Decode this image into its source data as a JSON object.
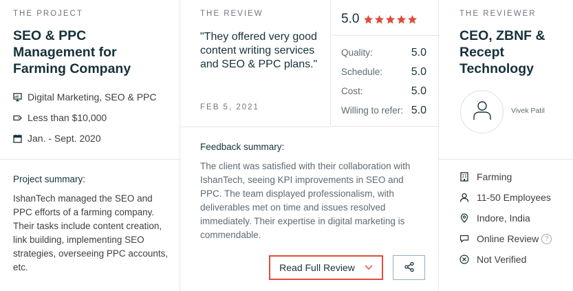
{
  "project": {
    "eyebrow": "THE PROJECT",
    "title": "SEO & PPC Management for Farming Company",
    "services": "Digital Marketing, SEO & PPC",
    "budget": "Less than $10,000",
    "dates": "Jan. - Sept. 2020",
    "summary_label": "Project summary:",
    "summary_text": "IshanTech managed the SEO and PPC efforts of a farming company. Their tasks include content creation, link building, implementing SEO strategies, overseeing PPC accounts, etc."
  },
  "review": {
    "eyebrow": "THE REVIEW",
    "quote": "\"They offered very good content writing services and SEO & PPC plans.\"",
    "date": "FEB 5, 2021",
    "overall": "5.0",
    "stars": 5,
    "star_color": "#e04b3a",
    "ratings": [
      {
        "label": "Quality:",
        "value": "5.0"
      },
      {
        "label": "Schedule:",
        "value": "5.0"
      },
      {
        "label": "Cost:",
        "value": "5.0"
      },
      {
        "label": "Willing to refer:",
        "value": "5.0"
      }
    ],
    "feedback_label": "Feedback summary:",
    "feedback_text": "The client was satisfied with their collaboration with IshanTech, seeing KPI improvements in SEO and PPC. The team displayed professionalism, with deliverables met on time and issues resolved immediately. Their expertise in digital marketing is commendable.",
    "read_full": "Read Full Review"
  },
  "reviewer": {
    "eyebrow": "THE REVIEWER",
    "title": "CEO, ZBNF & Recept Technology",
    "name": "Vivek Patil",
    "industry": "Farming",
    "size": "11-50 Employees",
    "location": "Indore, India",
    "review_type": "Online Review",
    "help_glyph": "?",
    "verification": "Not Verified"
  },
  "icons": {
    "services": "monitor-icon",
    "budget": "tag-icon",
    "dates": "calendar-icon",
    "industry": "building-icon",
    "size": "user-icon",
    "location": "map-pin-icon",
    "review_type": "chat-bubble-icon",
    "verification": "x-circle-icon",
    "share": "share-icon",
    "read_more": "chevron-down-icon",
    "avatar": "user-avatar-icon"
  },
  "colors": {
    "accent": "#e04b3a",
    "heading": "#17313b",
    "border": "#e3e8ec",
    "share_border": "#8fb1bf"
  }
}
